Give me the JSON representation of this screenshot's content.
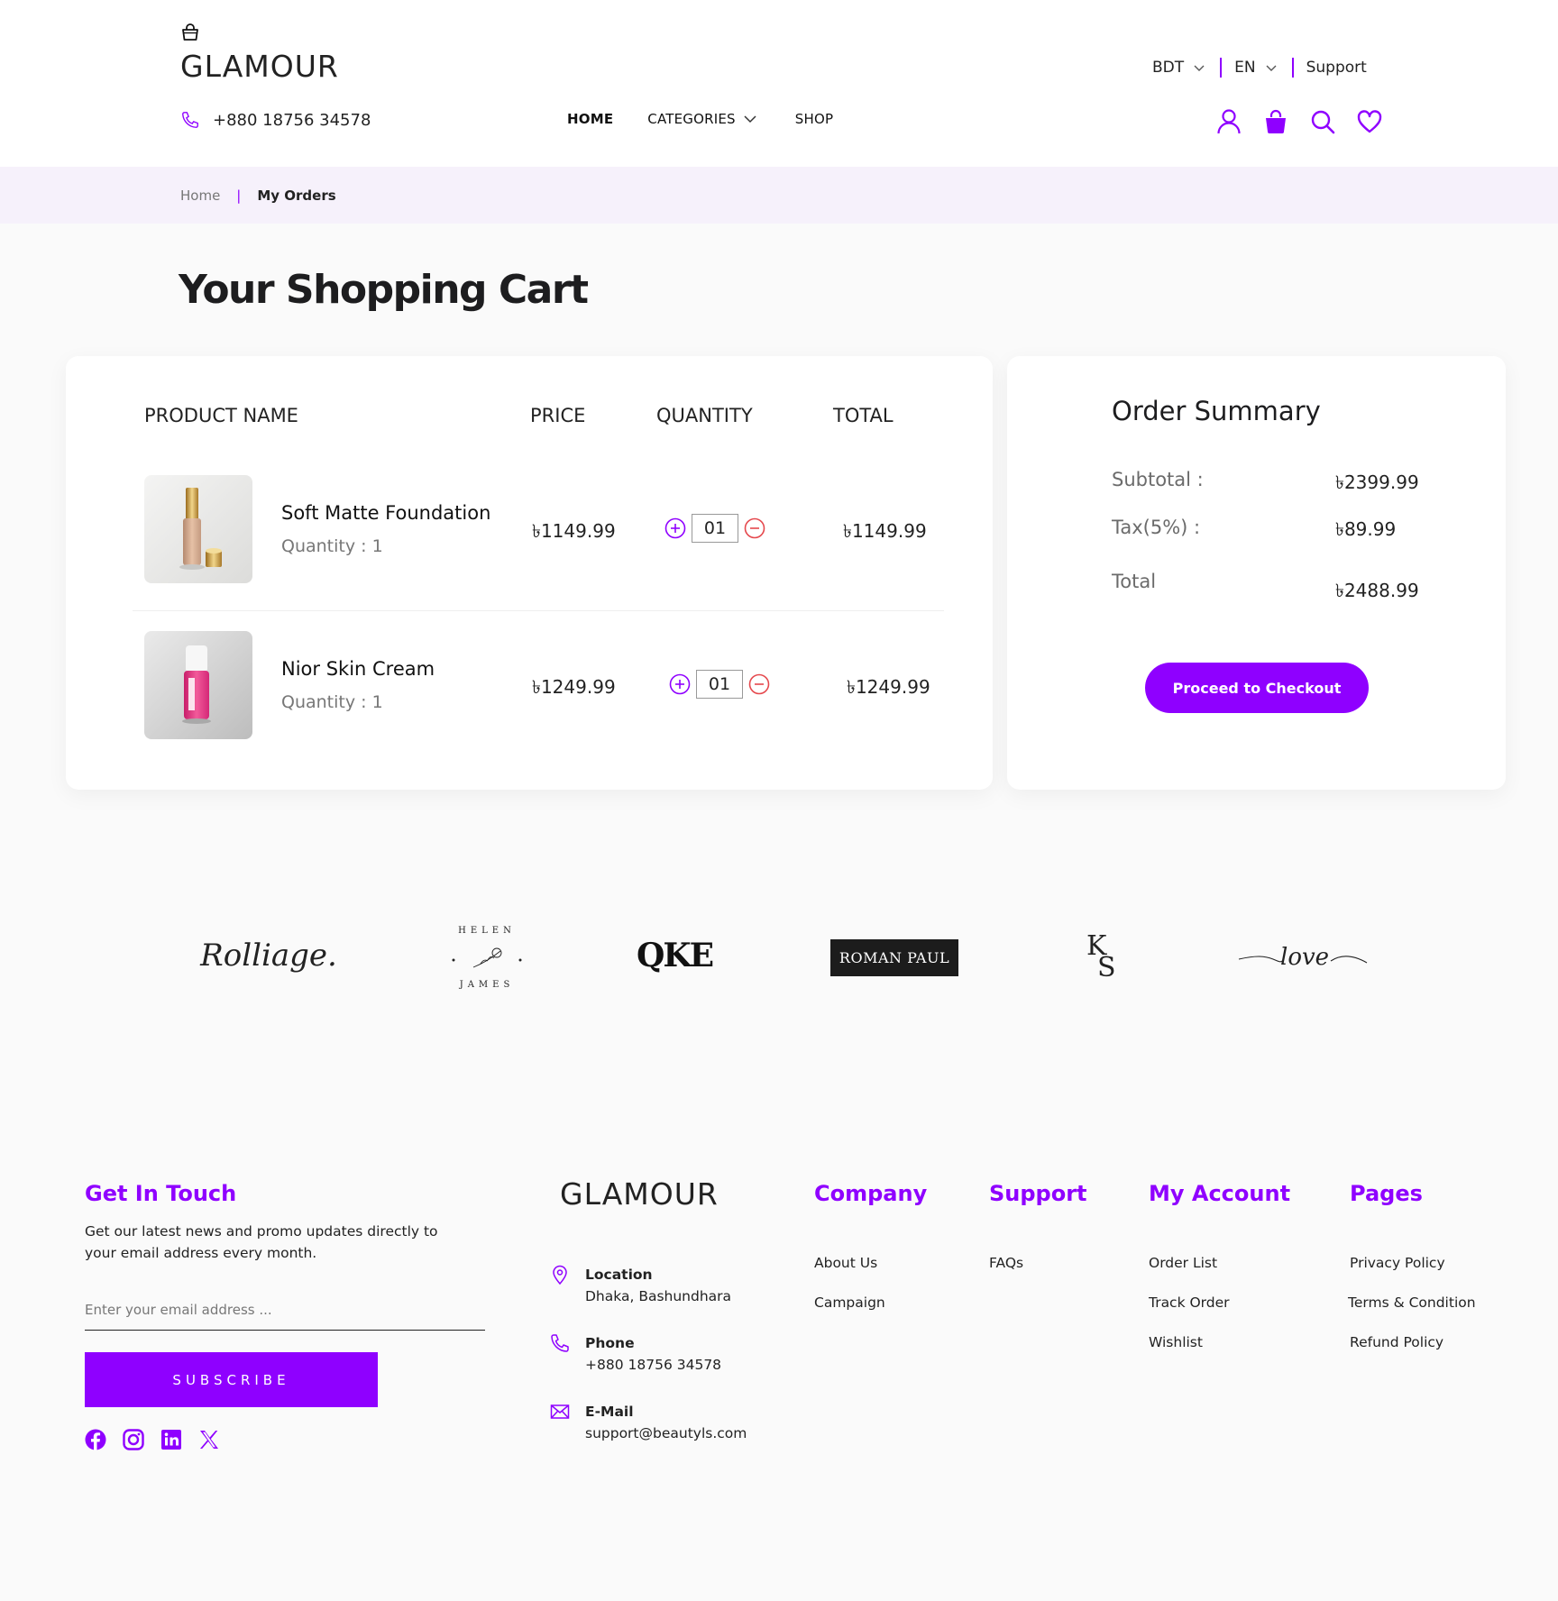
{
  "header": {
    "logo": "GLAMOUR",
    "phone": "+880 18756 34578",
    "nav": {
      "home": "HOME",
      "categories": "CATEGORIES",
      "shop": "SHOP"
    },
    "currency": "BDT",
    "language": "EN",
    "support": "Support",
    "icons": [
      "user-icon",
      "shopping-bag-icon",
      "search-icon",
      "heart-icon"
    ]
  },
  "breadcrumb": {
    "home": "Home",
    "separator": "|",
    "current": "My Orders"
  },
  "page_title": "Your Shopping Cart",
  "cart": {
    "columns": {
      "product": "PRODUCT NAME",
      "price": "PRICE",
      "quantity": "QUANTITY",
      "total": "TOTAL"
    },
    "items": [
      {
        "name": "Soft Matte Foundation",
        "qty_label": "Quantity : 1",
        "price": "৳1149.99",
        "qty": "01",
        "total": "৳1149.99"
      },
      {
        "name": "Nior Skin Cream",
        "qty_label": "Quantity : 1",
        "price": "৳1249.99",
        "qty": "01",
        "total": "৳1249.99"
      }
    ]
  },
  "summary": {
    "title": "Order Summary",
    "subtotal_label": "Subtotal :",
    "subtotal": "৳2399.99",
    "tax_label": "Tax(5%) :",
    "tax": "৳89.99",
    "total_label": "Total",
    "total": "৳2488.99",
    "checkout": "Proceed to Checkout"
  },
  "brands": {
    "rolliage": "Rolliage.",
    "helen_top": "HELEN",
    "helen_bottom": "JAMES",
    "qke": "QKE",
    "roman": "ROMAN PAUL",
    "ks_k": "K",
    "ks_s": "S",
    "love": "love"
  },
  "footer": {
    "get_in_touch": "Get In Touch",
    "newsletter_text": "Get our latest news and promo updates directly to your email address every month.",
    "email_placeholder": "Enter your email address ...",
    "subscribe": "SUBSCRIBE",
    "socials": [
      "facebook-icon",
      "instagram-icon",
      "linkedin-icon",
      "x-icon"
    ],
    "logo": "GLAMOUR",
    "location_label": "Location",
    "location": "Dhaka, Bashundhara",
    "phone_label": "Phone",
    "phone": "+880 18756 34578",
    "email_label": "E-Mail",
    "email": "support@beautyls.com",
    "company": {
      "heading": "Company",
      "links": [
        "About Us",
        "Campaign"
      ]
    },
    "support": {
      "heading": "Support",
      "links": [
        "FAQs"
      ]
    },
    "account": {
      "heading": "My Account",
      "links": [
        "Order List",
        "Track Order",
        "Wishlist"
      ]
    },
    "pages": {
      "heading": "Pages",
      "links": [
        "Privacy Policy",
        "Terms & Condition",
        "Refund Policy"
      ]
    }
  },
  "colors": {
    "accent": "#8f00ff",
    "breadcrumb_bg": "#f6f1fb",
    "minus": "#e5484d",
    "page_bg": "#fafafa"
  }
}
